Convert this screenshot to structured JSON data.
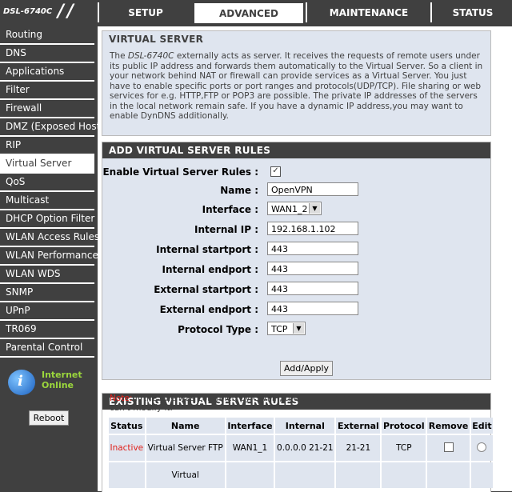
{
  "brand": {
    "model": "DSL-6740C"
  },
  "nav": {
    "tabs": [
      {
        "label": "SETUP"
      },
      {
        "label": "ADVANCED"
      },
      {
        "label": "MAINTENANCE"
      },
      {
        "label": "STATUS"
      }
    ],
    "active_tab": "ADVANCED"
  },
  "sidebar": {
    "items": [
      {
        "label": "Routing"
      },
      {
        "label": "DNS"
      },
      {
        "label": "Applications"
      },
      {
        "label": "Filter"
      },
      {
        "label": "Firewall"
      },
      {
        "label": "DMZ (Exposed Host)"
      },
      {
        "label": "RIP"
      },
      {
        "label": "Virtual Server"
      },
      {
        "label": "QoS"
      },
      {
        "label": "Multicast"
      },
      {
        "label": "DHCP Option Filter"
      },
      {
        "label": "WLAN Access Rules"
      },
      {
        "label": "WLAN Performance"
      },
      {
        "label": "WLAN WDS"
      },
      {
        "label": "SNMP"
      },
      {
        "label": "UPnP"
      },
      {
        "label": "TR069"
      },
      {
        "label": "Parental Control"
      }
    ],
    "active_item": "Virtual Server",
    "internet_status": {
      "line1": "Internet",
      "line2": "Online",
      "icon": "globe-info-icon",
      "color": "#9bd73c"
    },
    "reboot_label": "Reboot"
  },
  "virtual_server": {
    "title": "VIRTUAL SERVER",
    "desc_prefix": "The ",
    "desc_model": "DSL-6740C",
    "desc_body": " externally acts as server. It receives the requests of remote users under its public IP address and forwards them automatically to the Virtual Server. So a client in your network behind NAT or firewall can provide services as a Virtual Server. You just have to enable specific ports or port ranges and protocols(UDP/TCP). File sharing or web services for e.g. HTTP,FTP or POP3 are possible. The private IP addresses of the servers in the local network remain safe. If you have a dynamic IP address,you may want to enable DynDNS additionally."
  },
  "add_rules": {
    "title": "ADD VIRTUAL SERVER RULES",
    "enable_label": "Enable Virtual Server Rules :",
    "enable_checked": true,
    "name_label": "Name :",
    "name_value": "OpenVPN",
    "interface_label": "Interface :",
    "interface_value": "WAN1_2",
    "internal_ip_label": "Internal IP :",
    "internal_ip_value": "192.168.1.102",
    "internal_start_label": "Internal startport :",
    "internal_start_value": "443",
    "internal_end_label": "Internal endport :",
    "internal_end_value": "443",
    "external_start_label": "External startport :",
    "external_start_value": "443",
    "external_end_label": "External endport :",
    "external_end_value": "443",
    "protocol_label": "Protocol Type :",
    "protocol_value": "TCP",
    "apply_label": "Add/Apply"
  },
  "existing_rules": {
    "title": "EXISTING VIRTUAL SERVER RULES",
    "note_key": "Note:",
    "note_text": " If the rule was controled by CWMP, the status color will be purple or yellow, user can't modify it.",
    "columns": [
      "Status",
      "Name",
      "Interface",
      "Internal",
      "External",
      "Protocol",
      "Remove",
      "Edit"
    ],
    "rows": [
      {
        "status": "Inactive",
        "name": "Virtual Server FTP",
        "interface": "WAN1_1",
        "internal": "0.0.0.0 21-21",
        "external": "21-21",
        "protocol": "TCP"
      },
      {
        "status": "",
        "name": "Virtual",
        "interface": "",
        "internal": "",
        "external": "",
        "protocol": ""
      }
    ]
  },
  "colors": {
    "header_bg": "#404040",
    "panel_bg": "#dfe5ef",
    "inactive": "#e0201a"
  }
}
